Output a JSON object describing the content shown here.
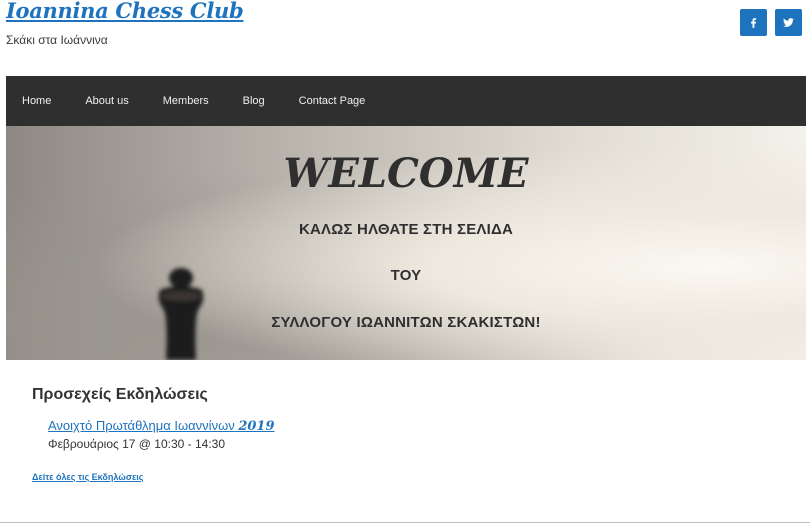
{
  "site": {
    "title": "Ioannina Chess Club",
    "tagline": "Σκάκι στα Ιωάννινα"
  },
  "social": {
    "icons": [
      "facebook-icon",
      "twitter-icon"
    ],
    "color": "#1e73be"
  },
  "nav": {
    "items": [
      "Home",
      "About us",
      "Members",
      "Blog",
      "Contact Page"
    ]
  },
  "hero": {
    "title": "WELCOME",
    "line1": "ΚΑΛΩΣ ΗΛΘΑΤΕ ΣΤΗ ΣΕΛΙΔΑ",
    "line2": "ΤΟΥ",
    "line3": "ΣΥΛΛΟΓΟΥ ΙΩΑΝΝΙΤΩΝ ΣΚΑΚΙΣΤΩΝ!"
  },
  "events": {
    "heading": "Προσεχείς Εκδηλώσεις",
    "items": [
      {
        "title": "Ανοιχτό Πρωτάθλημα Ιωαννίνων",
        "year": "2019",
        "time": "Φεβρουάριος 17 @ 10:30 - 14:30"
      }
    ],
    "view_all": "Δείτε όλες τις Εκδηλώσεις"
  },
  "colors": {
    "accent": "#1e73be",
    "navbar": "#2f2f2f"
  }
}
